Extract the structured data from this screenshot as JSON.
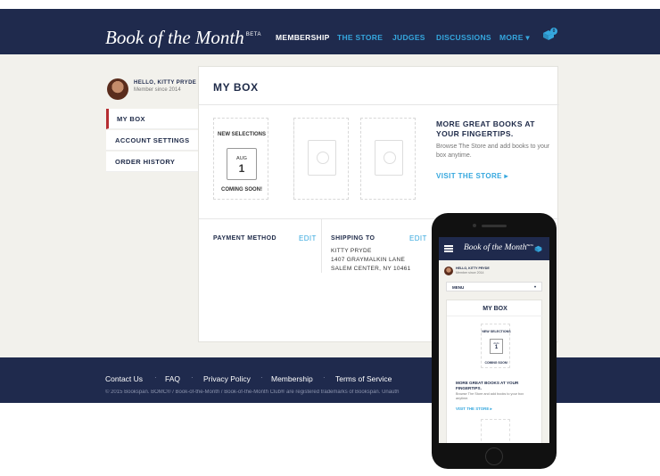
{
  "nav": {
    "logo": "Book of the Month",
    "beta": "BETA",
    "links": [
      "MEMBERSHIP",
      "THE STORE",
      "JUDGES",
      "DISCUSSIONS",
      "MORE ▾"
    ],
    "cart_count": "0"
  },
  "profile": {
    "hello": "HELLO, KITTY PRYDE",
    "member_since": "Member since 2014"
  },
  "sidebar": {
    "items": [
      {
        "label": "MY BOX"
      },
      {
        "label": "ACCOUNT SETTINGS"
      },
      {
        "label": "ORDER HISTORY"
      }
    ]
  },
  "main": {
    "title": "MY BOX",
    "new_selections": "NEW SELECTIONS",
    "cal_month": "AUG",
    "cal_day": "1",
    "coming_soon": "COMING SOON!",
    "more_title": "MORE GREAT BOOKS AT YOUR FINGERTIPS.",
    "more_body": "Browse The Store and add books to your box anytime.",
    "visit": "VISIT THE STORE ▸",
    "payment_label": "PAYMENT METHOD",
    "shipping_label": "SHIPPING TO",
    "edit": "EDIT",
    "address": [
      "KITTY PRYDE",
      "1407 GRAYMALKIN LANE",
      "SALEM CENTER, NY 10461"
    ]
  },
  "footer": {
    "links": [
      "Contact Us",
      "FAQ",
      "Privacy Policy",
      "Membership",
      "Terms of Service"
    ],
    "dot": "·",
    "copyright": "© 2015 Bookspan. BOMC® / Book-of-the-Month / Book-of-the-Month Club® are registered trademarks of Bookspan. Unauth"
  },
  "mobile": {
    "logo": "Book of the Month",
    "beta": "BETA",
    "hello": "HELLO, KITTY PRYDE",
    "member_since": "Member since 2014",
    "menu": "MENU",
    "menu_caret": "▾",
    "title": "MY BOX",
    "new_selections": "NEW SELECTIONS",
    "cal_month": "AUG",
    "cal_day": "1",
    "coming_soon": "COMING SOON!",
    "more_title": "MORE GREAT BOOKS AT YOUR FINGERTIPS.",
    "more_body": "Browse The Store and add books to your box anytime.",
    "visit": "VISIT THE STORE ▸"
  },
  "colors": {
    "navy": "#1f2a4d",
    "accent": "#35a7de",
    "active_marker": "#b52d31",
    "page_bg": "#f2f1ec"
  },
  "icons": [
    "cart-icon",
    "calendar-icon",
    "book-placeholder-icon",
    "hamburger-icon"
  ]
}
